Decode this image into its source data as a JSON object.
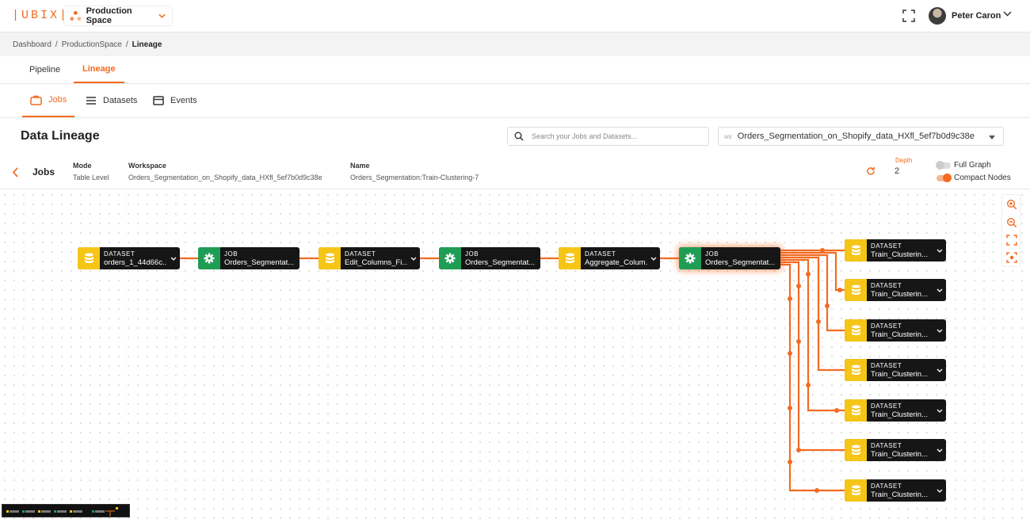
{
  "header": {
    "logo": "|UBIX|",
    "space_name": "Production Space",
    "user_name": "Peter Caron"
  },
  "breadcrumb": [
    "Dashboard",
    "/",
    "ProductionSpace",
    "/",
    "Lineage"
  ],
  "main_tabs": [
    {
      "label": "Pipeline",
      "active": false
    },
    {
      "label": "Lineage",
      "active": true
    }
  ],
  "sub_tabs": [
    {
      "label": "Jobs",
      "icon": "briefcase-icon",
      "active": true
    },
    {
      "label": "Datasets",
      "icon": "list-icon",
      "active": false
    },
    {
      "label": "Events",
      "icon": "events-icon",
      "active": false
    }
  ],
  "page_title": "Data Lineage",
  "search": {
    "placeholder_prefix": "Search your",
    "placeholder": "Search your Jobs and Datasets...",
    "placeholder_bold": "Jobs and Datasets..."
  },
  "workspace_select": {
    "prefix": "ws",
    "value": "Orders_Segmentation_on_Shopify_data_HXfl_5ef7b0d9c38e"
  },
  "info": {
    "section": "Jobs",
    "mode_label": "Mode",
    "mode_value": "Table Level",
    "workspace_label": "Workspace",
    "workspace_value": "Orders_Segmentation_on_Shopify_data_HXfl_5ef7b0d9c38e",
    "name_label": "Name",
    "name_value": "Orders_Segmentation:Train-Clustering-7",
    "depth_label": "Depth",
    "depth_value": "2",
    "full_graph_label": "Full Graph",
    "full_graph_on": false,
    "compact_nodes_label": "Compact Nodes",
    "compact_nodes_on": true
  },
  "colors": {
    "accent": "#f26b21",
    "dataset": "#f5c518",
    "job": "#1f9d55",
    "node_bg": "#161616"
  },
  "nodes": {
    "chain": [
      {
        "type": "DATASET",
        "name": "orders_1_44d66c..."
      },
      {
        "type": "JOB",
        "name": "Orders_Segmentat..."
      },
      {
        "type": "DATASET",
        "name": "Edit_Columns_Fi..."
      },
      {
        "type": "JOB",
        "name": "Orders_Segmentat..."
      },
      {
        "type": "DATASET",
        "name": "Aggregate_Colum..."
      },
      {
        "type": "JOB",
        "name": "Orders_Segmentat...",
        "selected": true
      }
    ],
    "outputs": [
      {
        "type": "DATASET",
        "name": "Train_Clusterin..."
      },
      {
        "type": "DATASET",
        "name": "Train_Clusterin..."
      },
      {
        "type": "DATASET",
        "name": "Train_Clusterin..."
      },
      {
        "type": "DATASET",
        "name": "Train_Clusterin..."
      },
      {
        "type": "DATASET",
        "name": "Train_Clusterin..."
      },
      {
        "type": "DATASET",
        "name": "Train_Clusterin..."
      },
      {
        "type": "DATASET",
        "name": "Train_Clusterin..."
      }
    ]
  }
}
